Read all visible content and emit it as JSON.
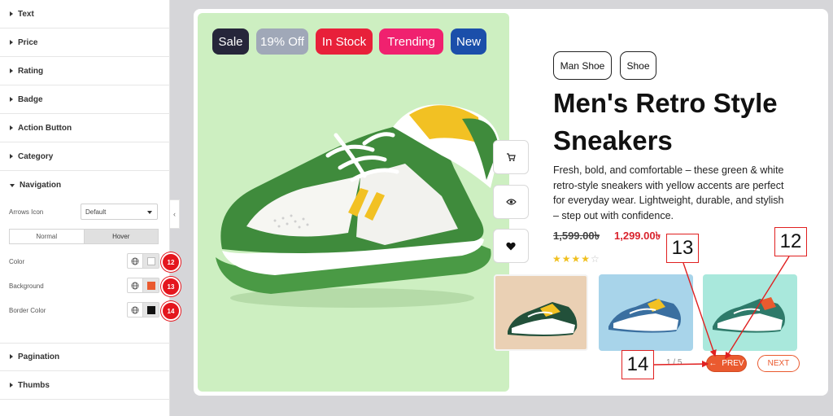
{
  "panel": {
    "sections": [
      {
        "label": "Text"
      },
      {
        "label": "Price"
      },
      {
        "label": "Rating"
      },
      {
        "label": "Badge"
      },
      {
        "label": "Action Button"
      },
      {
        "label": "Category"
      },
      {
        "label": "Navigation"
      }
    ],
    "nav_controls": {
      "arrows_icon_label": "Arrows Icon",
      "arrows_icon_value": "Default",
      "state_tabs": [
        "Normal",
        "Hover"
      ],
      "active_state": "Hover",
      "color_label": "Color",
      "background_label": "Background",
      "border_color_label": "Border Color",
      "color_swatch": "#ffffff",
      "background_swatch": "#ea5a2f",
      "border_swatch": "#111111",
      "badges": [
        "12",
        "13",
        "14"
      ]
    },
    "bottom_sections": [
      {
        "label": "Pagination"
      },
      {
        "label": "Thumbs"
      }
    ],
    "collapse_glyph": "‹"
  },
  "product": {
    "tags": [
      {
        "label": "Sale",
        "color": "#26263a"
      },
      {
        "label": "19% Off",
        "color": "#a0a8b8"
      },
      {
        "label": "In Stock",
        "color": "#e8203a"
      },
      {
        "label": "Trending",
        "color": "#f0216f"
      },
      {
        "label": "New",
        "color": "#1b4faa"
      }
    ],
    "categories": [
      "Man Shoe",
      "Shoe"
    ],
    "title_line1": "Men's Retro Style",
    "title_line2": "Sneakers",
    "description": "Fresh, bold, and comfortable – these green & white retro-style sneakers with yellow accents are perfect for everyday wear. Lightweight, durable, and stylish – step out with confidence.",
    "price_old": "1,599.00৳",
    "price_new": "1,299.00৳",
    "rating": 4,
    "rating_max": 5,
    "stars_filled": "★★★★",
    "stars_empty": "☆",
    "pager": "1 / 5",
    "prev_label": "PREV",
    "prev_arrow": "←",
    "next_label": "NEXT",
    "thumb_backgrounds": [
      "#ead0b4",
      "#a8d4ea",
      "#a9e8dc"
    ]
  },
  "annotations": {
    "callouts": [
      "13",
      "12",
      "14"
    ]
  },
  "colors": {
    "accent": "#ea5a2f",
    "shoe_green": "#3f8b3c",
    "shoe_yellow": "#f2c123",
    "badge_red": "#e4161e"
  }
}
